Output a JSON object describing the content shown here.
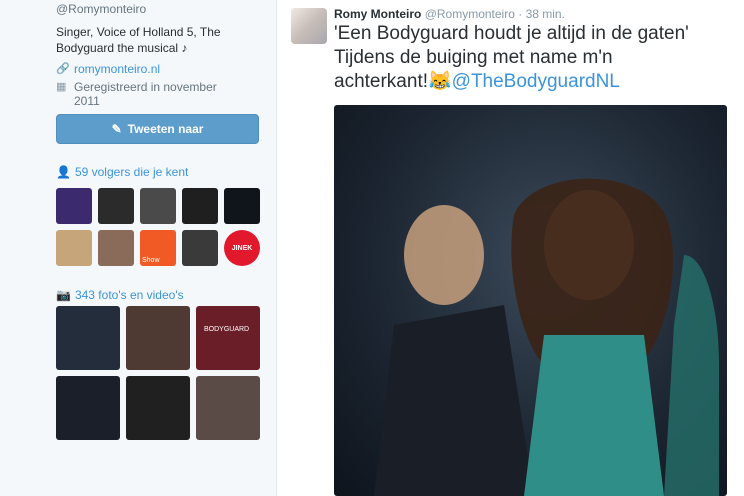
{
  "profile": {
    "handle": "@Romymonteiro",
    "bio_line1": "Singer, Voice of Holland 5, The",
    "bio_line2": "Bodyguard the musical ♪",
    "website": "romymonteiro.nl",
    "joined_line1": "Geregistreerd in november",
    "joined_line2": "2011",
    "tweet_button": "Tweeten naar",
    "followers_known": "59 volgers die je kent",
    "media_count": "343 foto's en video's"
  },
  "avatars": [
    {
      "name": "avatar-1",
      "color": "#3c2a6e"
    },
    {
      "name": "avatar-2",
      "color": "#2b2b2b"
    },
    {
      "name": "avatar-3",
      "color": "#4a4a4a"
    },
    {
      "name": "avatar-4",
      "color": "#1f1f1f"
    },
    {
      "name": "avatar-5",
      "color": "#10151c"
    },
    {
      "name": "avatar-6",
      "color": "#c7a57a"
    },
    {
      "name": "avatar-7",
      "color": "#8a6a58"
    },
    {
      "name": "avatar-8",
      "color": "#f15a24"
    },
    {
      "name": "avatar-9",
      "color": "#3a3a3a"
    },
    {
      "name": "avatar-10",
      "color": "#e2192c"
    }
  ],
  "avatar_texts": {
    "avatar8": "Show",
    "avatar10": "JINEK"
  },
  "photos": [
    {
      "color": "#242d3b"
    },
    {
      "color": "#4e3a33"
    },
    {
      "color": "#6a1e28"
    },
    {
      "color": "#1a1f29"
    },
    {
      "color": "#202020"
    },
    {
      "color": "#5b4b46"
    }
  ],
  "photo_texts": {
    "photo3": "BODYGUARD"
  },
  "tweet": {
    "name": "Romy Monteiro",
    "handle": "@Romymonteiro",
    "time": "· 38 min.",
    "text_line1": "'Een Bodyguard houdt je altijd in de gaten'",
    "text_line2": "Tijdens de buiging met name m'n",
    "text_line3": "achterkant!😹",
    "mention": "@TheBodyguardNL"
  }
}
